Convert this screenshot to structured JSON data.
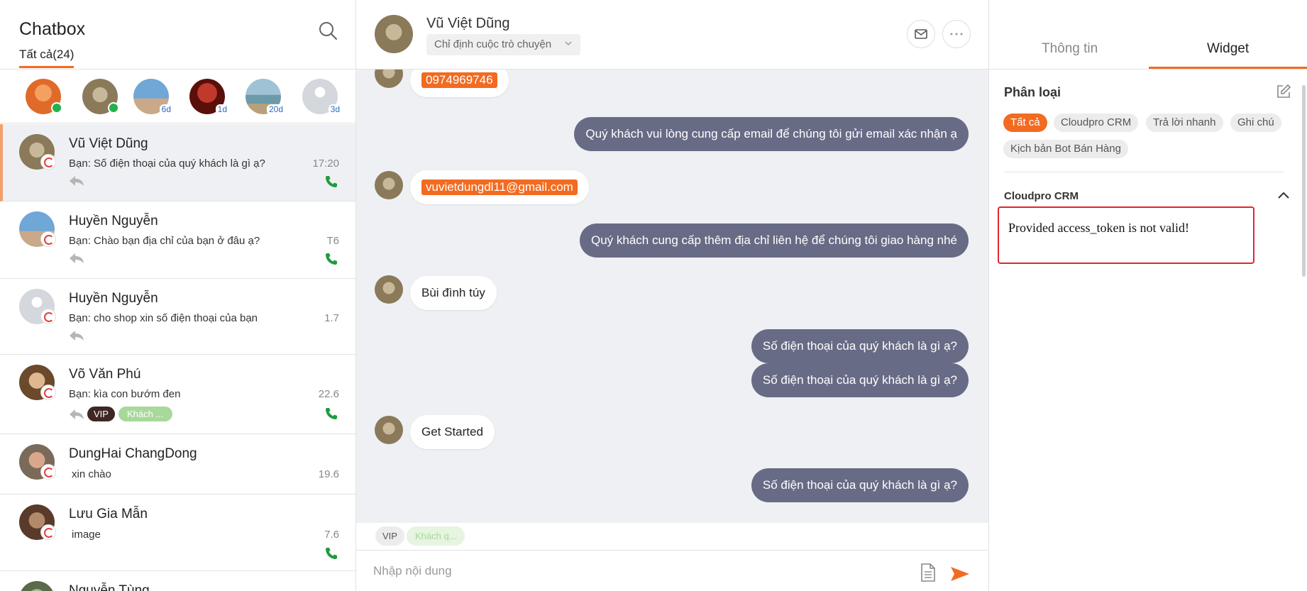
{
  "sidebar": {
    "title": "Chatbox",
    "filter_tab": "Tất cả(24)",
    "stories": [
      {
        "ago": "",
        "online": true,
        "color": "#e06a2a"
      },
      {
        "ago": "",
        "online": true,
        "color": "#8a7a5a"
      },
      {
        "ago": "6d",
        "online": false,
        "color": "#6fa7d6"
      },
      {
        "ago": "1d",
        "online": false,
        "color": "#8c1a12"
      },
      {
        "ago": "20d",
        "online": false,
        "color": "#6c9aa8"
      },
      {
        "ago": "3d",
        "online": false,
        "color": "#d4d7dc"
      }
    ],
    "conversations": [
      {
        "name": "Vũ Việt Dũng",
        "preview": "Bạn: Số điện thoại của quý khách là gì ạ?",
        "time": "17:20"
      },
      {
        "name": "Huyền Nguyễn",
        "preview": "Bạn: Chào bạn địa chỉ của bạn ở đâu ạ?",
        "time": "T6"
      },
      {
        "name": "Huyền Nguyễn",
        "preview": "Bạn: cho shop xin số điện thoại của bạn",
        "time": "1.7"
      },
      {
        "name": "Võ Văn Phú",
        "preview": "Bạn: kìa con bướm đen",
        "time": "22.6",
        "tags": [
          "VIP",
          "Khách ..."
        ]
      },
      {
        "name": "DungHai ChangDong",
        "preview": "xin chào",
        "time": "19.6"
      },
      {
        "name": "Lưu Gia Mẫn",
        "preview": "image",
        "time": "7.6"
      },
      {
        "name": "Nguyễn Tùng",
        "preview": "",
        "time": ""
      }
    ]
  },
  "chat": {
    "contact_name": "Vũ Việt Dũng",
    "assign_placeholder": "Chỉ định cuộc trò chuyện",
    "messages": [
      {
        "dir": "in",
        "text": "0974969746",
        "highlight": true
      },
      {
        "dir": "out",
        "text": "Quý khách vui lòng cung cấp email để chúng tôi gửi email xác nhận ạ"
      },
      {
        "dir": "in",
        "text": "vuvietdungdl11@gmail.com",
        "highlight": true
      },
      {
        "dir": "out",
        "text": "Quý khách cung cấp thêm địa chỉ liên hệ để chúng tôi giao hàng nhé"
      },
      {
        "dir": "in",
        "text": "Bùi đình túy"
      },
      {
        "dir": "out",
        "text": "Số điện thoại của quý khách là gì ạ?"
      },
      {
        "dir": "out",
        "text": "Số điện thoại của quý khách là gì ạ?"
      },
      {
        "dir": "in",
        "text": "Get Started"
      },
      {
        "dir": "out",
        "text": "Số điện thoại của quý khách là gì ạ?"
      }
    ],
    "tags": [
      "VIP",
      "Khách q..."
    ],
    "composer_placeholder": "Nhập nội dung"
  },
  "panel": {
    "tabs": [
      "Thông tin",
      "Widget"
    ],
    "active_tab": "Widget",
    "section_title": "Phân loại",
    "chips": [
      "Tất cả",
      "Cloudpro CRM",
      "Trả lời nhanh",
      "Ghi chú",
      "Kịch bản Bot Bán Hàng"
    ],
    "active_chip": "Tất cả",
    "widget_title": "Cloudpro CRM",
    "error_message": "Provided access_token is not valid!"
  },
  "colors": {
    "accent": "#f26b21",
    "outgoing_bubble": "#686b85",
    "error_border": "#e0262f",
    "online": "#22b14c"
  }
}
